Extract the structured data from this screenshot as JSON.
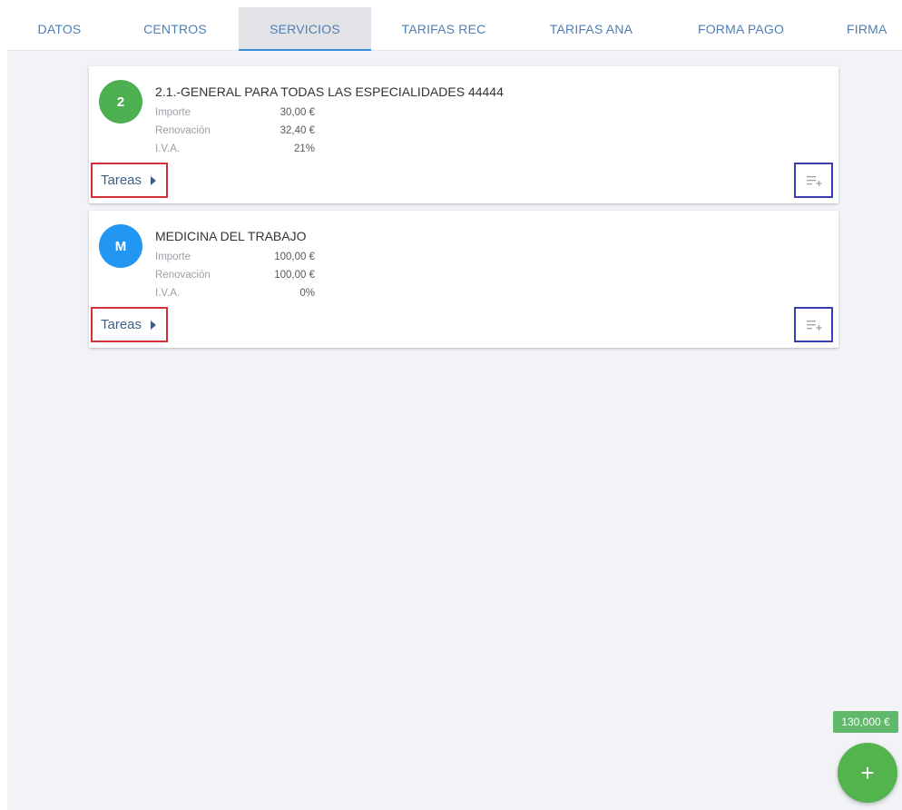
{
  "tabs": [
    {
      "label": "DATOS",
      "active": false
    },
    {
      "label": "CENTROS",
      "active": false
    },
    {
      "label": "SERVICIOS",
      "active": true
    },
    {
      "label": "TARIFAS REC",
      "active": false
    },
    {
      "label": "TARIFAS ANA",
      "active": false
    },
    {
      "label": "FORMA PAGO",
      "active": false
    },
    {
      "label": "FIRMA",
      "active": false
    }
  ],
  "services": [
    {
      "avatar": {
        "text": "2",
        "color": "#4caf50"
      },
      "title": "2.1.-GENERAL PARA TODAS LAS ESPECIALIDADES 44444",
      "details": [
        {
          "label": "Importe",
          "value": "30,00 €"
        },
        {
          "label": "Renovación",
          "value": "32,40 €"
        },
        {
          "label": "I.V.A.",
          "value": "21%"
        }
      ],
      "tasks_label": "Tareas",
      "tasks_icon": "caret-right-icon",
      "add_icon": "playlist-add-icon"
    },
    {
      "avatar": {
        "text": "M",
        "color": "#2196f3"
      },
      "title": "MEDICINA DEL TRABAJO",
      "details": [
        {
          "label": "Importe",
          "value": "100,00 €"
        },
        {
          "label": "Renovación",
          "value": "100,00 €"
        },
        {
          "label": "I.V.A.",
          "value": "0%"
        }
      ],
      "tasks_label": "Tareas",
      "tasks_icon": "caret-right-icon",
      "add_icon": "playlist-add-icon"
    }
  ],
  "total": "130,000 €",
  "fab": {
    "icon": "plus-icon",
    "symbol": "+",
    "color": "#53b34d"
  },
  "colors": {
    "accent": "#3b8ed8",
    "tab_text": "#4f7fb3",
    "tasks_highlight": "#d33139",
    "add_highlight": "#3b3db3",
    "total_badge": "#60b96b",
    "background": "#f2f3f7"
  }
}
